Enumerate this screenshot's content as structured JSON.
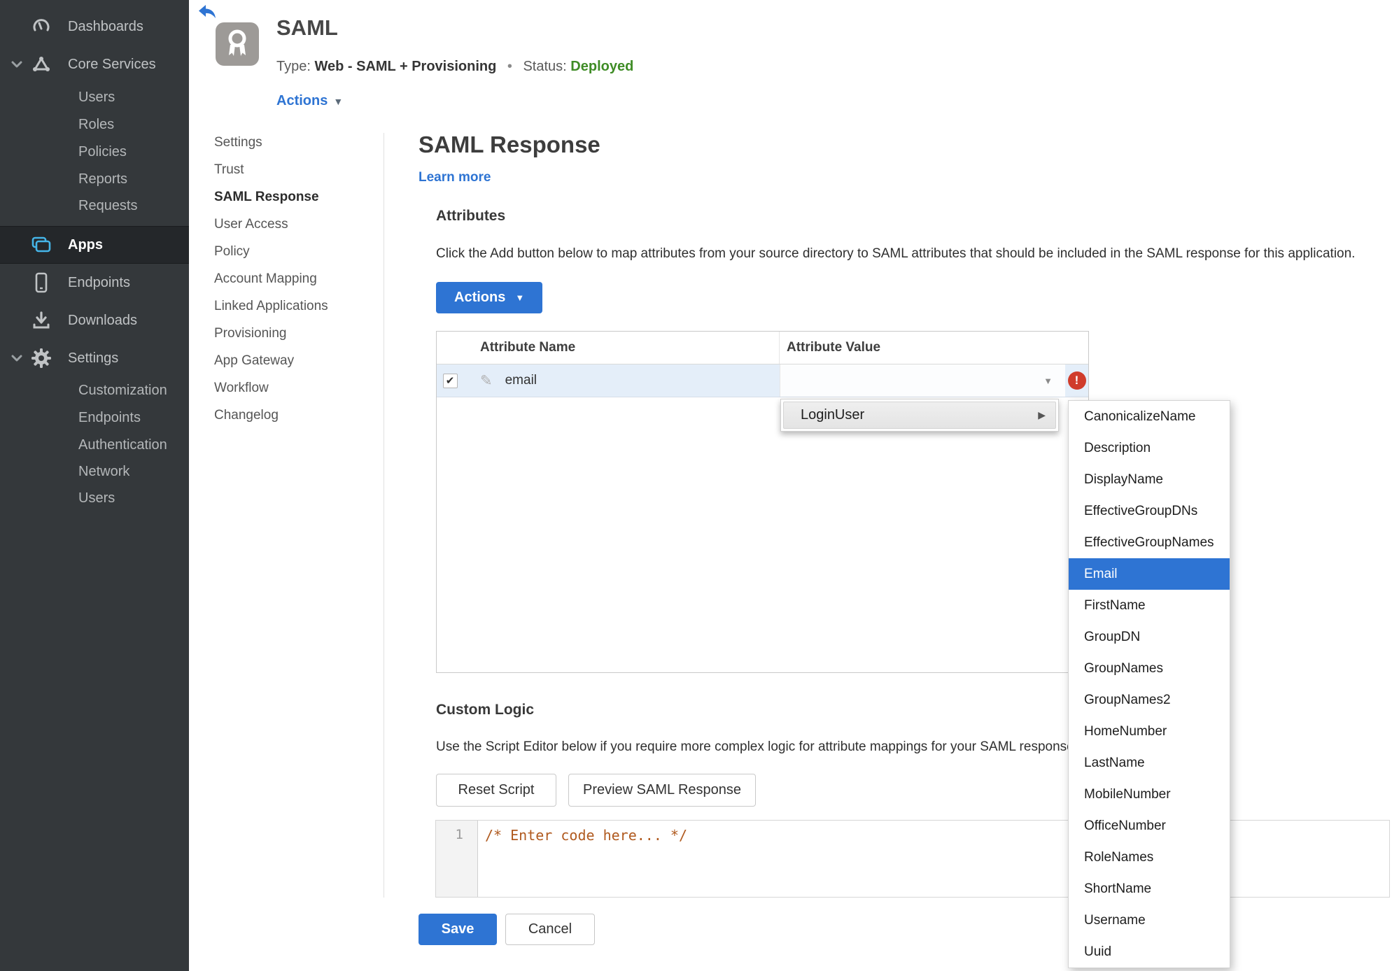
{
  "colors": {
    "accent_blue": "#2e74d3",
    "status_green": "#3f8c26",
    "error_red": "#d03c2b",
    "apps_icon_cyan": "#45b5e8",
    "sidebar_bg": "#34383b",
    "row_highlight": "#e4eef9",
    "code_comment": "#b05a1f"
  },
  "icons": {
    "caret_down": "▼",
    "submenu_arrow": "▶",
    "check": "✔",
    "pencil": "✎",
    "error_bang": "!"
  },
  "sidebar": {
    "items": [
      {
        "label": "Dashboards"
      },
      {
        "label": "Core Services"
      },
      {
        "label": "Users"
      },
      {
        "label": "Roles"
      },
      {
        "label": "Policies"
      },
      {
        "label": "Reports"
      },
      {
        "label": "Requests"
      },
      {
        "label": "Apps"
      },
      {
        "label": "Endpoints"
      },
      {
        "label": "Downloads"
      },
      {
        "label": "Settings"
      },
      {
        "label": "Customization"
      },
      {
        "label": "Endpoints"
      },
      {
        "label": "Authentication"
      },
      {
        "label": "Network"
      },
      {
        "label": "Users"
      }
    ],
    "selected_item": "Apps"
  },
  "header": {
    "app_name": "SAML",
    "type_label": "Type:",
    "type_value": "Web - SAML + Provisioning",
    "separator": "•",
    "status_label": "Status:",
    "status_value": "Deployed",
    "actions_label": "Actions"
  },
  "subnav": {
    "items": [
      {
        "label": "Settings"
      },
      {
        "label": "Trust"
      },
      {
        "label": "SAML Response"
      },
      {
        "label": "User Access"
      },
      {
        "label": "Policy"
      },
      {
        "label": "Account Mapping"
      },
      {
        "label": "Linked Applications"
      },
      {
        "label": "Provisioning"
      },
      {
        "label": "App Gateway"
      },
      {
        "label": "Workflow"
      },
      {
        "label": "Changelog"
      }
    ],
    "active_item": "SAML Response"
  },
  "main": {
    "title": "SAML Response",
    "learn_more": "Learn more",
    "attributes": {
      "heading": "Attributes",
      "description": "Click the Add button below to map attributes from your source directory to SAML attributes that should be included in the SAML response for this application.",
      "actions_button": "Actions",
      "table": {
        "columns": [
          "",
          "Attribute Name",
          "Attribute Value"
        ],
        "rows": [
          {
            "checked": true,
            "name": "email",
            "value": "",
            "error": true
          }
        ]
      }
    },
    "value_menu": {
      "label": "LoginUser"
    },
    "submenu": {
      "items": [
        "CanonicalizeName",
        "Description",
        "DisplayName",
        "EffectiveGroupDNs",
        "EffectiveGroupNames",
        "Email",
        "FirstName",
        "GroupDN",
        "GroupNames",
        "GroupNames2",
        "HomeNumber",
        "LastName",
        "MobileNumber",
        "OfficeNumber",
        "RoleNames",
        "ShortName",
        "Username",
        "Uuid"
      ],
      "selected_item": "Email"
    },
    "custom_logic": {
      "heading": "Custom Logic",
      "description": "Use the Script Editor below if you require more complex logic for attribute mappings for your SAML response.",
      "reset_button": "Reset Script",
      "preview_button": "Preview SAML Response"
    },
    "editor": {
      "line_number": "1",
      "code": "/* Enter code here... */"
    },
    "footer": {
      "save": "Save",
      "cancel": "Cancel"
    }
  }
}
